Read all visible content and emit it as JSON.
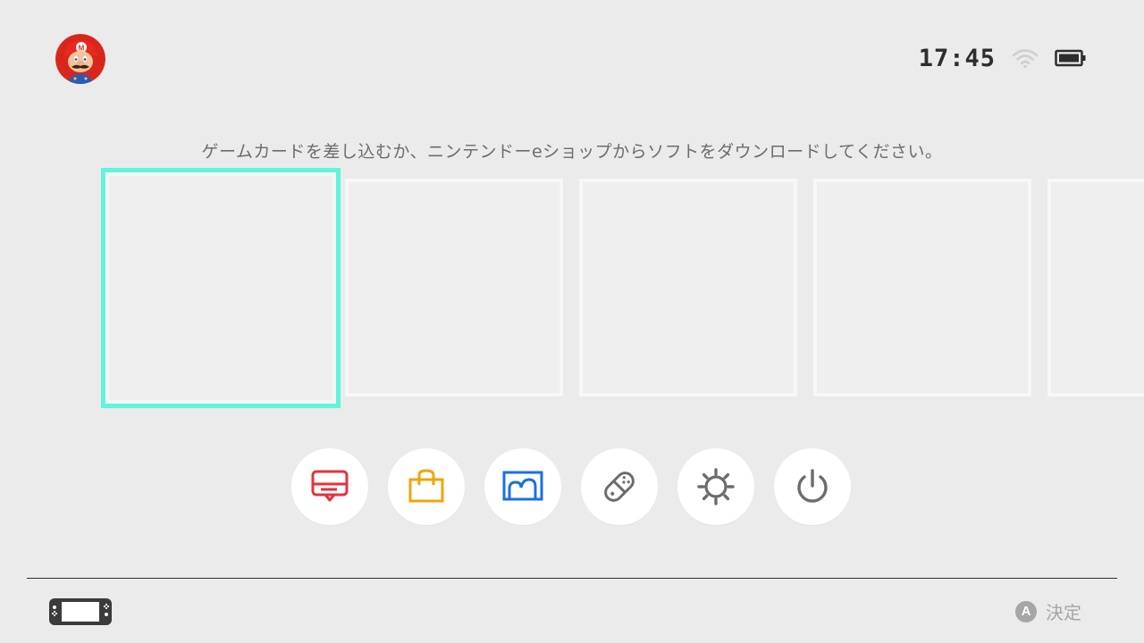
{
  "header": {
    "clock": "17:45",
    "user": {
      "avatar": "mario-avatar-icon"
    },
    "status_icons": [
      "wifi-icon",
      "battery-icon"
    ]
  },
  "main": {
    "instruction": "ゲームカードを差し込むか、ニンテンドーeショップからソフトをダウンロードしてください。",
    "selected_tile_color": "#5ef6da"
  },
  "dock": {
    "items": [
      {
        "icon": "news-icon",
        "color": "#e4323c"
      },
      {
        "icon": "eshop-bag-icon",
        "color": "#f0a40b"
      },
      {
        "icon": "album-icon",
        "color": "#1a6fe3"
      },
      {
        "icon": "controller-icon",
        "color": "#6c6c6c"
      },
      {
        "icon": "settings-gear-icon",
        "color": "#6c6c6c"
      },
      {
        "icon": "power-icon",
        "color": "#6c6c6c"
      }
    ]
  },
  "footer": {
    "button_glyph": "A",
    "hint_label": "決定",
    "console_icon": "switch-console-icon"
  }
}
